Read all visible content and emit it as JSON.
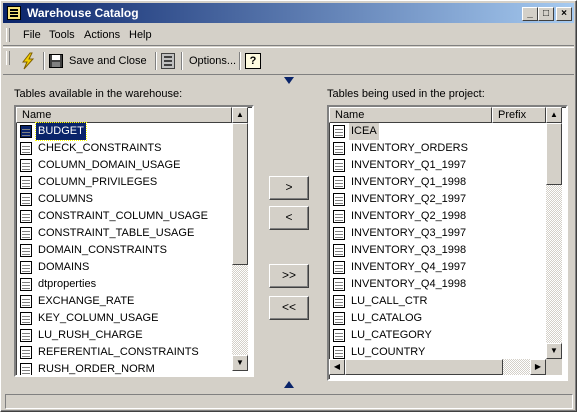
{
  "window": {
    "title": "Warehouse Catalog"
  },
  "menu": [
    "File",
    "Tools",
    "Actions",
    "Help"
  ],
  "toolbar": {
    "save_close": "Save and Close",
    "options": "Options...",
    "help_icon_label": "?"
  },
  "left_panel": {
    "label": "Tables available in the warehouse:",
    "column_name": "Name",
    "items": [
      "BUDGET",
      "CHECK_CONSTRAINTS",
      "COLUMN_DOMAIN_USAGE",
      "COLUMN_PRIVILEGES",
      "COLUMNS",
      "CONSTRAINT_COLUMN_USAGE",
      "CONSTRAINT_TABLE_USAGE",
      "DOMAIN_CONSTRAINTS",
      "DOMAINS",
      "dtproperties",
      "EXCHANGE_RATE",
      "KEY_COLUMN_USAGE",
      "LU_RUSH_CHARGE",
      "REFERENTIAL_CONSTRAINTS",
      "RUSH_ORDER_NORM"
    ],
    "selected": "BUDGET"
  },
  "right_panel": {
    "label": "Tables being used in the project:",
    "column_name": "Name",
    "column_prefix": "Prefix",
    "items": [
      "ICEA",
      "INVENTORY_ORDERS",
      "INVENTORY_Q1_1997",
      "INVENTORY_Q1_1998",
      "INVENTORY_Q2_1997",
      "INVENTORY_Q2_1998",
      "INVENTORY_Q3_1997",
      "INVENTORY_Q3_1998",
      "INVENTORY_Q4_1997",
      "INVENTORY_Q4_1998",
      "LU_CALL_CTR",
      "LU_CATALOG",
      "LU_CATEGORY",
      "LU_COUNTRY"
    ],
    "highlighted": "ICEA"
  },
  "buttons": {
    "add_one": ">",
    "remove_one": "<",
    "add_all": ">>",
    "remove_all": "<<"
  },
  "icons": {
    "app": "warehouse-catalog-icon",
    "update": "lightning-icon",
    "save": "floppy-disk-icon",
    "options": "options-icon",
    "help": "help-icon",
    "table": "table-icon"
  },
  "colors": {
    "title_start": "#0a246a",
    "title_end": "#a6caf0",
    "selection": "#0a246a",
    "arrow_marker": "#0a246a"
  }
}
